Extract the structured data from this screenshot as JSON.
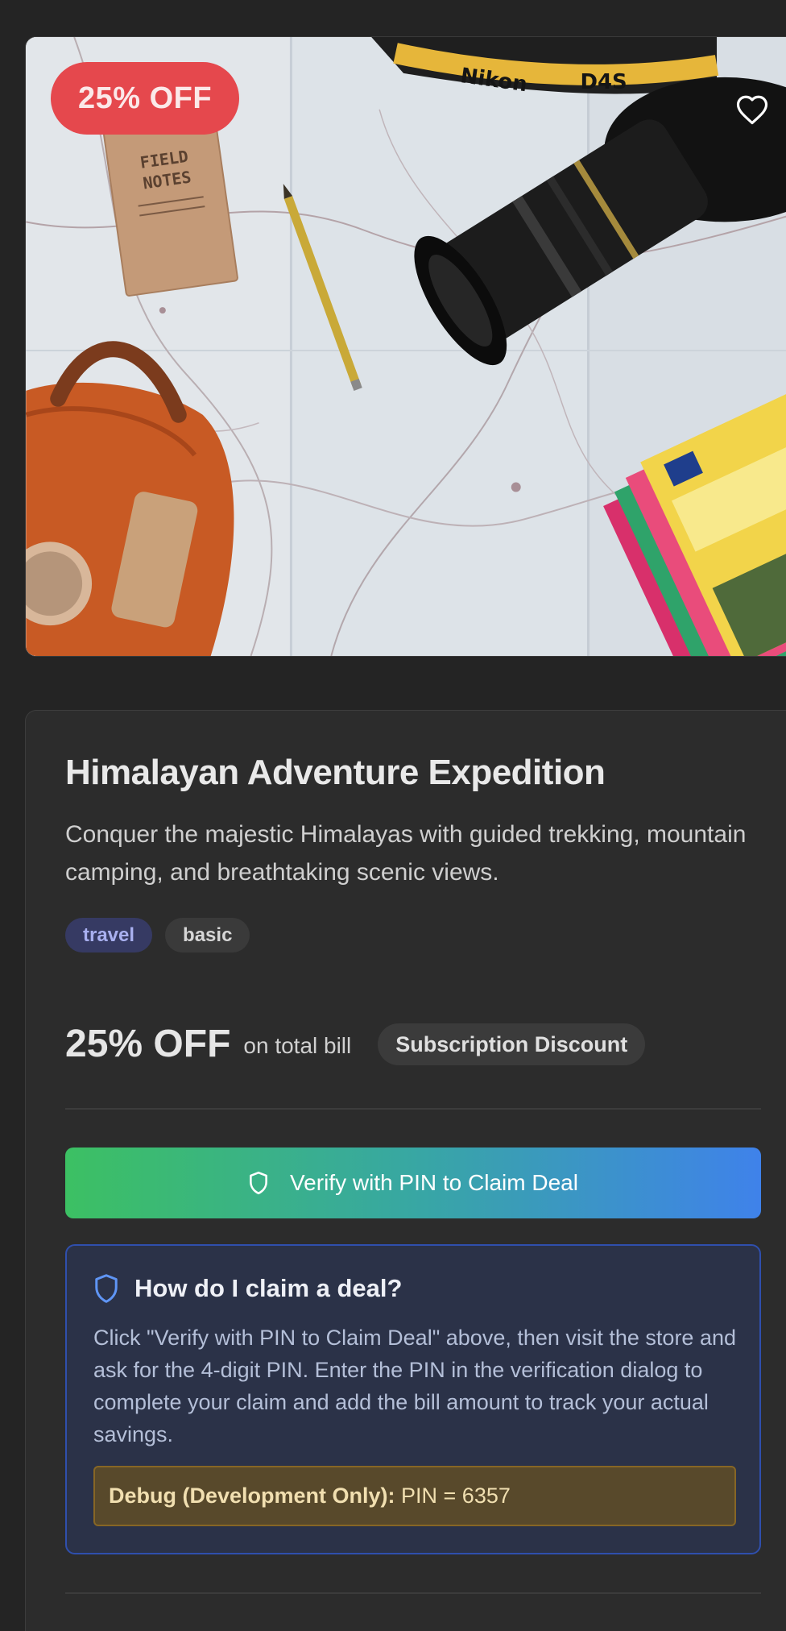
{
  "hero": {
    "discount_label": "25% OFF",
    "image_alt": "Travel flat-lay: map, field notes, pencil, camera, backpack, guidebooks",
    "notebook_text": "FIELD NOTES",
    "strap_text": "Nikon",
    "icons": {
      "favorite": "heart-outline-icon"
    }
  },
  "deal": {
    "title": "Himalayan Adventure Expedition",
    "description": "Conquer the majestic Himalayas with guided trekking, mountain camping, and breathtaking scenic views.",
    "tags": [
      "travel",
      "basic"
    ],
    "offer_value": "25% OFF",
    "offer_scope": "on total bill",
    "offer_type": "Subscription Discount",
    "claim_button": "Verify with PIN to Claim Deal",
    "claim_icon": "shield-icon"
  },
  "howto": {
    "title": "How do I claim a deal?",
    "icon": "shield-icon",
    "body": "Click \"Verify with PIN to Claim Deal\" above, then visit the store and ask for the 4-digit PIN. Enter the PIN in the verification dialog to complete your claim and add the bill amount to track your actual savings.",
    "debug_label": "Debug (Development Only):",
    "debug_value": " PIN = 6357"
  },
  "colors": {
    "page_bg": "#242424",
    "card_bg": "#2c2c2c",
    "discount_red": "#e5484d",
    "gradient_start": "#3cc063",
    "gradient_end": "#3f82ea",
    "info_bg": "#2b3248",
    "info_border": "#2f4fad",
    "debug_bg": "#58492b"
  }
}
